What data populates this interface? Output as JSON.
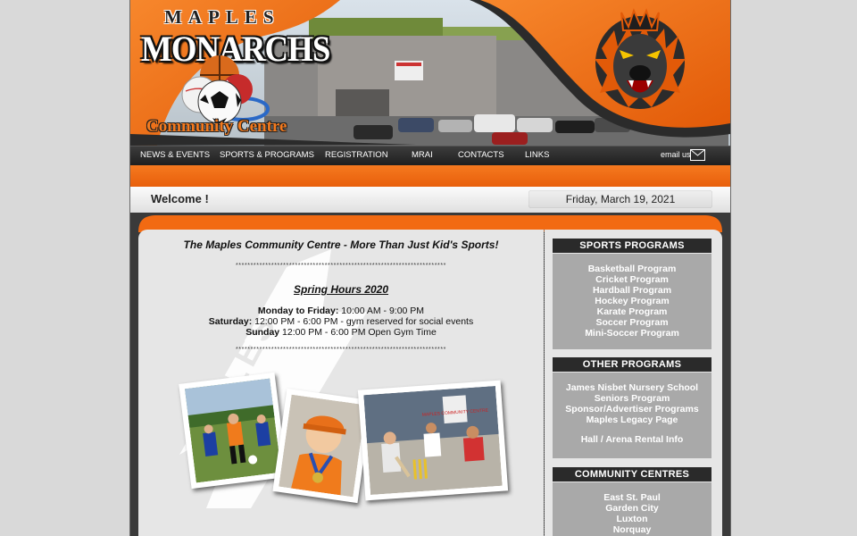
{
  "banner": {
    "logo_maples": "MAPLES",
    "logo_monarchs": "MONARCHS",
    "logo_community_centre": "Community Centre",
    "colors": {
      "accent": "#f26a12",
      "dark": "#2a2a2a"
    }
  },
  "nav": {
    "items": [
      {
        "label": "NEWS & EVENTS"
      },
      {
        "label": "SPORTS & PROGRAMS"
      },
      {
        "label": "REGISTRATION"
      },
      {
        "label": "MRAI"
      },
      {
        "label": "CONTACTS"
      },
      {
        "label": "LINKS"
      }
    ],
    "email_label": "email us",
    "email_icon": "mail-icon"
  },
  "welcome": {
    "text": "Welcome !",
    "date": "Friday, March 19, 2021"
  },
  "main": {
    "tagline": "The Maples Community Centre - More Than Just Kid's Sports!",
    "stars": "***********************************************************************",
    "hours_title": "Spring Hours 2020",
    "hours": [
      {
        "label": "Monday to Friday:",
        "value": " 10:00 AM - 9:00 PM"
      },
      {
        "label": "Saturday:",
        "value": " 12:00 PM - 6:00 PM - gym reserved for social events"
      },
      {
        "label": "Sunday",
        "value": " 12:00 PM - 6:00 PM Open Gym Time"
      }
    ],
    "watermark": "MAPLES",
    "photo_sign": "MAPLES COMMUNITY CENTRE"
  },
  "sidebar": {
    "sports": {
      "title": "SPORTS PROGRAMS",
      "links": [
        "Basketball Program",
        "Cricket Program",
        "Hardball Program",
        "Hockey Program",
        "Karate Program",
        "Soccer Program",
        "Mini-Soccer Program"
      ]
    },
    "other": {
      "title": "OTHER PROGRAMS",
      "links": [
        "James Nisbet Nursery School",
        "Seniors Program",
        "Sponsor/Advertiser Programs",
        "Maples Legacy Page"
      ],
      "extra": "Hall / Arena Rental Info"
    },
    "centres": {
      "title": "COMMUNITY CENTRES",
      "links": [
        "East St. Paul",
        "Garden City",
        "Luxton",
        "Norquay"
      ]
    }
  }
}
